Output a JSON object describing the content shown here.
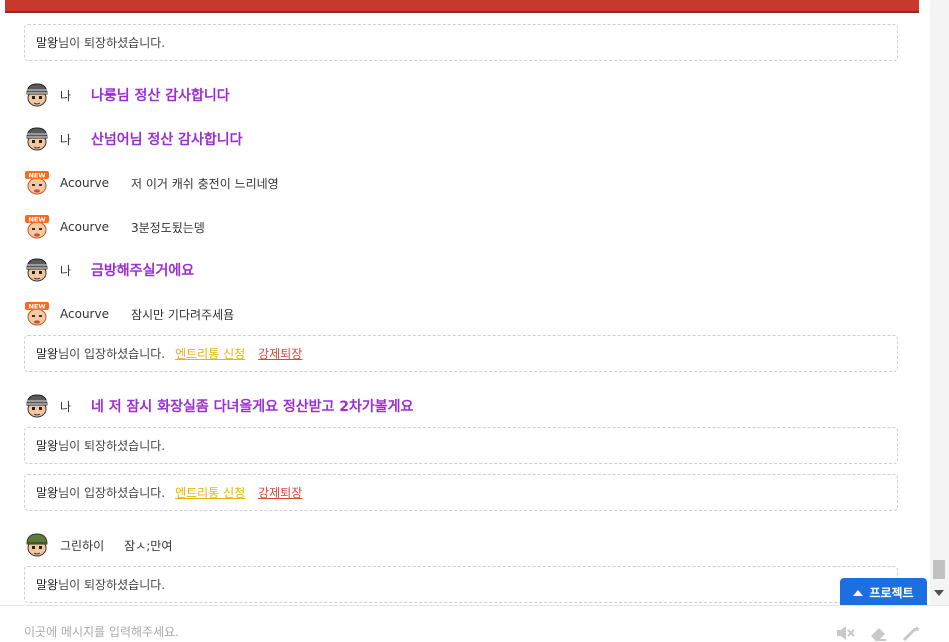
{
  "header": {
    "accent_color": "#c8382c"
  },
  "chat": {
    "messages": [
      {
        "type": "system",
        "nick": "말왕",
        "text": "님이 퇴장하셨습니다."
      },
      {
        "type": "chat",
        "avatar": "soldier-helmet-icon",
        "sender": "나",
        "text": "나룽님 정산 감사합니다",
        "is_me": true
      },
      {
        "type": "chat",
        "avatar": "soldier-helmet-icon",
        "sender": "나",
        "text": "산넘어님 정산 감사합니다",
        "is_me": true
      },
      {
        "type": "chat",
        "avatar": "new-user-icon",
        "sender": "Acourve",
        "text": "저 이거 캐쉬 충전이 느리네영",
        "is_me": false
      },
      {
        "type": "chat",
        "avatar": "new-user-icon",
        "sender": "Acourve",
        "text": "3분정도됬는뎅",
        "is_me": false
      },
      {
        "type": "chat",
        "avatar": "soldier-helmet-icon",
        "sender": "나",
        "text": "금방해주실거에요",
        "is_me": true
      },
      {
        "type": "chat",
        "avatar": "new-user-icon",
        "sender": "Acourve",
        "text": "잠시만 기다려주세욤",
        "is_me": false
      },
      {
        "type": "system",
        "nick": "말왕",
        "text": "님이 입장하셨습니다.",
        "entry_label": "엔트리통 신청",
        "kick_label": "강제퇴장"
      },
      {
        "type": "chat",
        "avatar": "soldier-helmet-icon",
        "sender": "나",
        "text": "네 저 잠시 화장실좀 다녀올게요 정산받고 2차가볼게요",
        "is_me": true
      },
      {
        "type": "system",
        "nick": "말왕",
        "text": "님이 퇴장하셨습니다."
      },
      {
        "type": "system",
        "nick": "말왕",
        "text": "님이 입장하셨습니다.",
        "entry_label": "엔트리통 신청",
        "kick_label": "강제퇴장"
      },
      {
        "type": "chat",
        "avatar": "green-helmet-icon",
        "sender": "그린하이",
        "text": "잠ㅅ;만여",
        "is_me": false
      },
      {
        "type": "system",
        "nick": "말왕",
        "text": "님이 퇴장하셨습니다."
      }
    ]
  },
  "project_button": {
    "label": "프로젝트"
  },
  "input": {
    "placeholder": "이곳에 메시지를 입력해주세요.",
    "value": ""
  },
  "tools": {
    "icons": [
      "mute-icon",
      "eraser-icon",
      "magic-wand-icon"
    ]
  },
  "colors": {
    "me_text": "#9b2fd2",
    "entry_link": "#e8b400",
    "kick_link": "#d8463a",
    "project_button": "#1d6fe0"
  }
}
